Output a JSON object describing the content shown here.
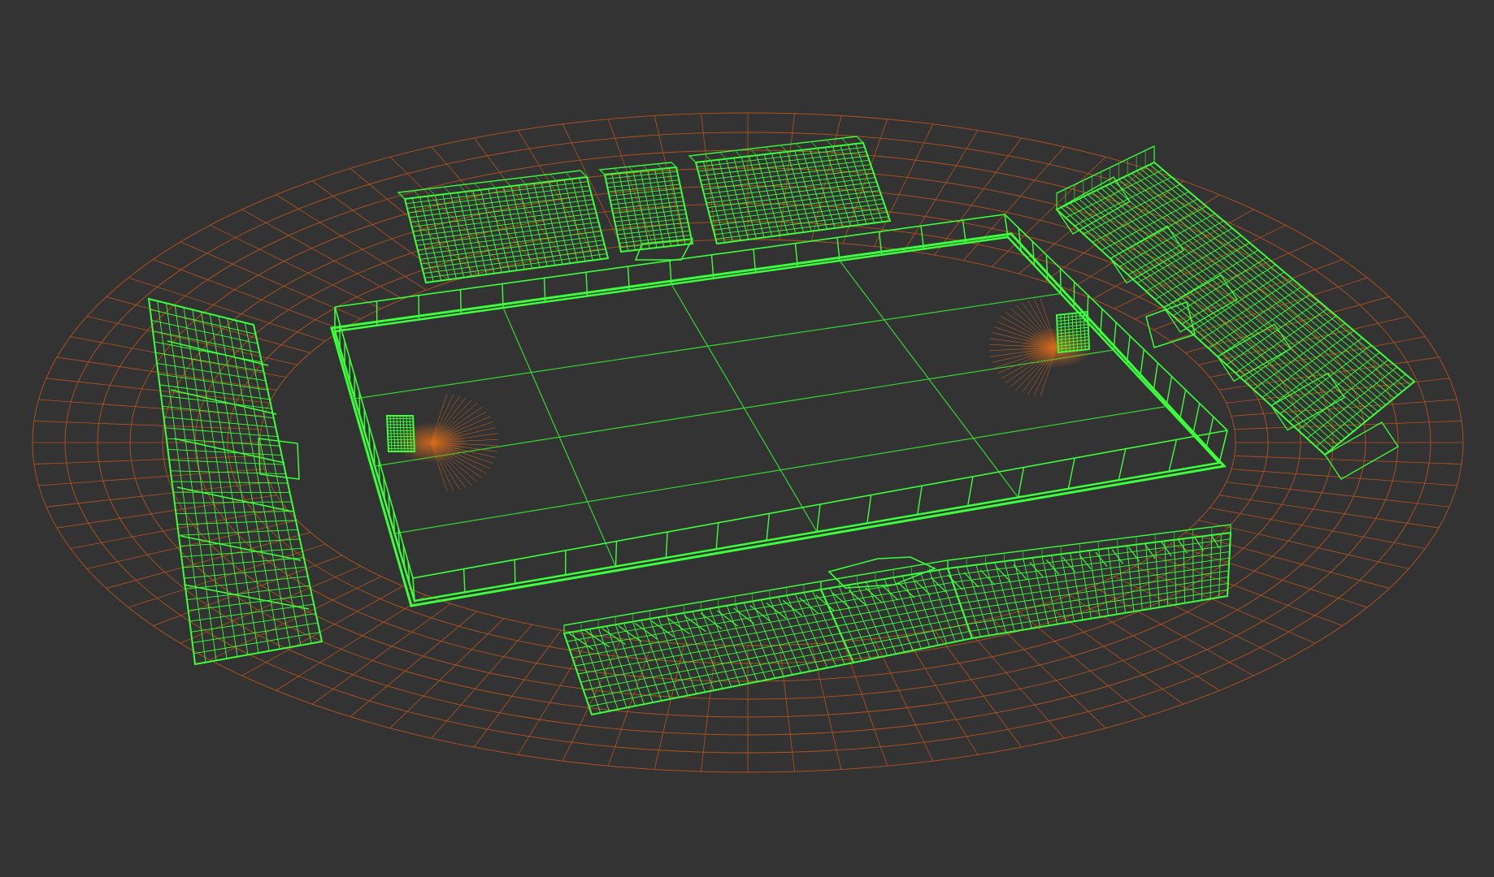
{
  "viewport": {
    "background": "#333333",
    "colors": {
      "wire": "#3bff3b",
      "wire_dim": "#27c827",
      "track_grid": "#b4531f",
      "field_lines": "#34d634",
      "goal_glow": "#d46a1c"
    },
    "scene": {
      "objects": [
        {
          "name": "track-grid",
          "kind": "ground-mesh"
        },
        {
          "name": "pitch",
          "kind": "field-plane"
        },
        {
          "name": "perimeter-wall",
          "kind": "barrier"
        },
        {
          "name": "north-stand",
          "kind": "grandstand"
        },
        {
          "name": "south-stand",
          "kind": "grandstand"
        },
        {
          "name": "west-stand",
          "kind": "grandstand"
        },
        {
          "name": "east-stand",
          "kind": "grandstand"
        },
        {
          "name": "west-goal",
          "kind": "goal"
        },
        {
          "name": "east-goal",
          "kind": "goal"
        }
      ]
    }
  }
}
